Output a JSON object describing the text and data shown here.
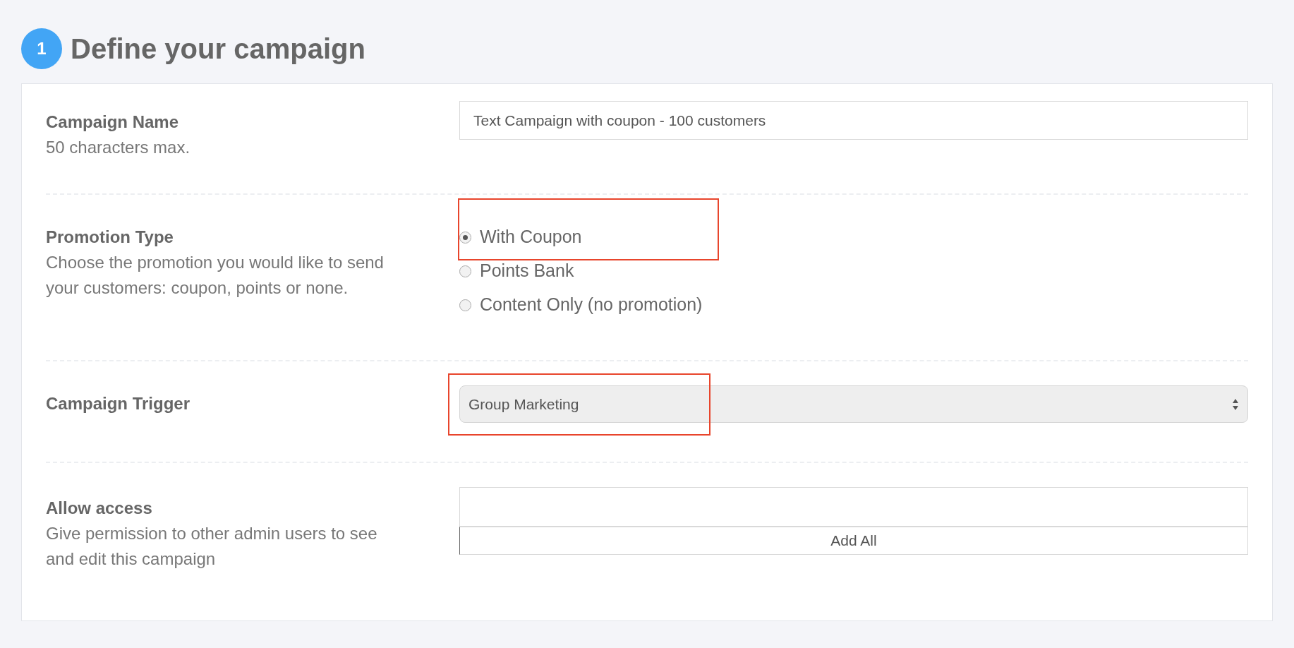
{
  "step": {
    "number": "1",
    "title": "Define your campaign"
  },
  "fields": [
    {
      "kind": "text",
      "label": "Campaign Name",
      "help": "50 characters max.",
      "value": "Text Campaign with coupon - 100 customers",
      "highlighted": false
    },
    {
      "kind": "radio",
      "label": "Promotion Type",
      "help": "Choose the promotion you would like to send your customers: coupon, points or none.",
      "highlighted": true,
      "options": [
        {
          "label": "With Coupon",
          "selected": true
        },
        {
          "label": "Points Bank",
          "selected": false
        },
        {
          "label": "Content Only (no promotion)",
          "selected": false
        }
      ]
    },
    {
      "kind": "select",
      "label": "Campaign Trigger",
      "value": "Group Marketing",
      "highlighted": true
    },
    {
      "kind": "multi",
      "label": "Allow access",
      "help": "Give permission to other admin users to see and edit this campaign",
      "button": "Add All",
      "highlighted": false
    }
  ]
}
